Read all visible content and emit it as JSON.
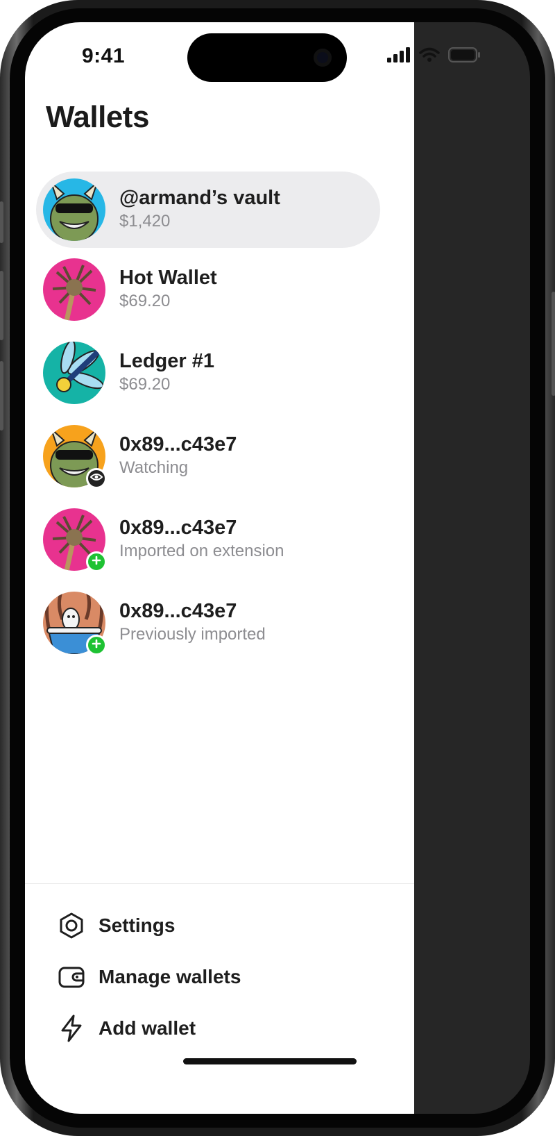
{
  "status": {
    "time": "9:41"
  },
  "drawer": {
    "title": "Wallets",
    "wallets": [
      {
        "name": "@armand’s vault",
        "subtitle": "$1,420",
        "avatar": "horned-monster-cyan",
        "badge": "",
        "active": true
      },
      {
        "name": "Hot Wallet",
        "subtitle": "$69.20",
        "avatar": "palm-tree-pink",
        "badge": ""
      },
      {
        "name": "Ledger #1",
        "subtitle": "$69.20",
        "avatar": "dragonfly-teal",
        "badge": ""
      },
      {
        "name": "0x89...c43e7",
        "subtitle": "Watching",
        "avatar": "horned-monster-orange",
        "badge": "eye-icon"
      },
      {
        "name": "0x89...c43e7",
        "subtitle": "Imported on extension",
        "avatar": "palm-tree-pink",
        "badge": "plus-icon"
      },
      {
        "name": "0x89...c43e7",
        "subtitle": "Previously imported",
        "avatar": "ghost-bathtub-brown",
        "badge": "plus-icon"
      }
    ],
    "menu": [
      {
        "label": "Settings",
        "icon": "gear-hexagon-icon"
      },
      {
        "label": "Manage wallets",
        "icon": "wallet-icon"
      },
      {
        "label": "Add wallet",
        "icon": "lightning-bolt-icon"
      }
    ]
  },
  "colors": {
    "active_row": "#ececee",
    "subtitle_text": "#8d8d91",
    "add_badge": "#1ec233",
    "overlay": "#262626"
  }
}
